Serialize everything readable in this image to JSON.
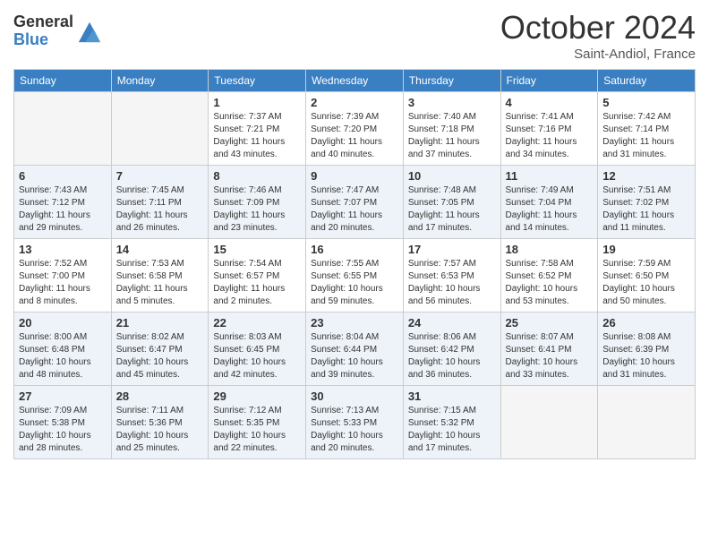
{
  "header": {
    "logo_general": "General",
    "logo_blue": "Blue",
    "month_title": "October 2024",
    "subtitle": "Saint-Andiol, France"
  },
  "columns": [
    "Sunday",
    "Monday",
    "Tuesday",
    "Wednesday",
    "Thursday",
    "Friday",
    "Saturday"
  ],
  "weeks": [
    [
      {
        "day": "",
        "info": ""
      },
      {
        "day": "",
        "info": ""
      },
      {
        "day": "1",
        "info": "Sunrise: 7:37 AM\nSunset: 7:21 PM\nDaylight: 11 hours and 43 minutes."
      },
      {
        "day": "2",
        "info": "Sunrise: 7:39 AM\nSunset: 7:20 PM\nDaylight: 11 hours and 40 minutes."
      },
      {
        "day": "3",
        "info": "Sunrise: 7:40 AM\nSunset: 7:18 PM\nDaylight: 11 hours and 37 minutes."
      },
      {
        "day": "4",
        "info": "Sunrise: 7:41 AM\nSunset: 7:16 PM\nDaylight: 11 hours and 34 minutes."
      },
      {
        "day": "5",
        "info": "Sunrise: 7:42 AM\nSunset: 7:14 PM\nDaylight: 11 hours and 31 minutes."
      }
    ],
    [
      {
        "day": "6",
        "info": "Sunrise: 7:43 AM\nSunset: 7:12 PM\nDaylight: 11 hours and 29 minutes."
      },
      {
        "day": "7",
        "info": "Sunrise: 7:45 AM\nSunset: 7:11 PM\nDaylight: 11 hours and 26 minutes."
      },
      {
        "day": "8",
        "info": "Sunrise: 7:46 AM\nSunset: 7:09 PM\nDaylight: 11 hours and 23 minutes."
      },
      {
        "day": "9",
        "info": "Sunrise: 7:47 AM\nSunset: 7:07 PM\nDaylight: 11 hours and 20 minutes."
      },
      {
        "day": "10",
        "info": "Sunrise: 7:48 AM\nSunset: 7:05 PM\nDaylight: 11 hours and 17 minutes."
      },
      {
        "day": "11",
        "info": "Sunrise: 7:49 AM\nSunset: 7:04 PM\nDaylight: 11 hours and 14 minutes."
      },
      {
        "day": "12",
        "info": "Sunrise: 7:51 AM\nSunset: 7:02 PM\nDaylight: 11 hours and 11 minutes."
      }
    ],
    [
      {
        "day": "13",
        "info": "Sunrise: 7:52 AM\nSunset: 7:00 PM\nDaylight: 11 hours and 8 minutes."
      },
      {
        "day": "14",
        "info": "Sunrise: 7:53 AM\nSunset: 6:58 PM\nDaylight: 11 hours and 5 minutes."
      },
      {
        "day": "15",
        "info": "Sunrise: 7:54 AM\nSunset: 6:57 PM\nDaylight: 11 hours and 2 minutes."
      },
      {
        "day": "16",
        "info": "Sunrise: 7:55 AM\nSunset: 6:55 PM\nDaylight: 10 hours and 59 minutes."
      },
      {
        "day": "17",
        "info": "Sunrise: 7:57 AM\nSunset: 6:53 PM\nDaylight: 10 hours and 56 minutes."
      },
      {
        "day": "18",
        "info": "Sunrise: 7:58 AM\nSunset: 6:52 PM\nDaylight: 10 hours and 53 minutes."
      },
      {
        "day": "19",
        "info": "Sunrise: 7:59 AM\nSunset: 6:50 PM\nDaylight: 10 hours and 50 minutes."
      }
    ],
    [
      {
        "day": "20",
        "info": "Sunrise: 8:00 AM\nSunset: 6:48 PM\nDaylight: 10 hours and 48 minutes."
      },
      {
        "day": "21",
        "info": "Sunrise: 8:02 AM\nSunset: 6:47 PM\nDaylight: 10 hours and 45 minutes."
      },
      {
        "day": "22",
        "info": "Sunrise: 8:03 AM\nSunset: 6:45 PM\nDaylight: 10 hours and 42 minutes."
      },
      {
        "day": "23",
        "info": "Sunrise: 8:04 AM\nSunset: 6:44 PM\nDaylight: 10 hours and 39 minutes."
      },
      {
        "day": "24",
        "info": "Sunrise: 8:06 AM\nSunset: 6:42 PM\nDaylight: 10 hours and 36 minutes."
      },
      {
        "day": "25",
        "info": "Sunrise: 8:07 AM\nSunset: 6:41 PM\nDaylight: 10 hours and 33 minutes."
      },
      {
        "day": "26",
        "info": "Sunrise: 8:08 AM\nSunset: 6:39 PM\nDaylight: 10 hours and 31 minutes."
      }
    ],
    [
      {
        "day": "27",
        "info": "Sunrise: 7:09 AM\nSunset: 5:38 PM\nDaylight: 10 hours and 28 minutes."
      },
      {
        "day": "28",
        "info": "Sunrise: 7:11 AM\nSunset: 5:36 PM\nDaylight: 10 hours and 25 minutes."
      },
      {
        "day": "29",
        "info": "Sunrise: 7:12 AM\nSunset: 5:35 PM\nDaylight: 10 hours and 22 minutes."
      },
      {
        "day": "30",
        "info": "Sunrise: 7:13 AM\nSunset: 5:33 PM\nDaylight: 10 hours and 20 minutes."
      },
      {
        "day": "31",
        "info": "Sunrise: 7:15 AM\nSunset: 5:32 PM\nDaylight: 10 hours and 17 minutes."
      },
      {
        "day": "",
        "info": ""
      },
      {
        "day": "",
        "info": ""
      }
    ]
  ]
}
